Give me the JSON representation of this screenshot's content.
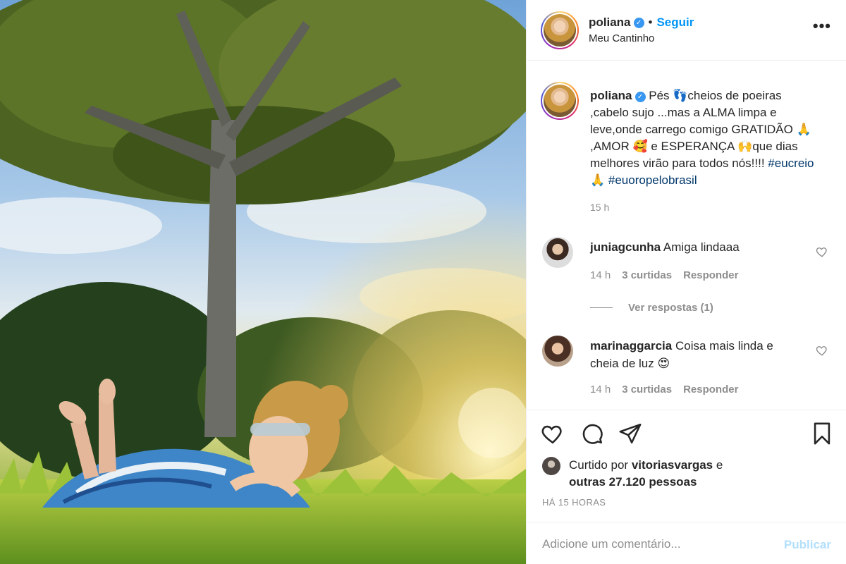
{
  "header": {
    "username": "poliana",
    "follow_label": "Seguir",
    "dot": "•",
    "location": "Meu Cantinho",
    "more_icon": "more-horizontal-icon"
  },
  "caption": {
    "username": "poliana",
    "text_part1": "Pés 👣cheios de poeiras ,cabelo sujo ...mas a ALMA limpa e leve,onde carrego comigo GRATIDÃO 🙏 ,AMOR 🥰 e ESPERANÇA 🙌que dias melhores virão para todos nós!!!! ",
    "tag1": "#eucreio",
    "tag_sep": "🙏 ",
    "tag2": "#euoropelobrasil",
    "time": "15 h"
  },
  "comments": [
    {
      "username": "juniagcunha",
      "text": "Amiga lindaaa",
      "time": "14 h",
      "likes": "3 curtidas",
      "reply_label": "Responder",
      "view_replies": "Ver respostas (1)"
    },
    {
      "username": "marinaggarcia",
      "text": "Coisa mais linda e cheia de luz 😍",
      "time": "14 h",
      "likes": "3 curtidas",
      "reply_label": "Responder"
    }
  ],
  "likes": {
    "prefix": "Curtido por",
    "user": "vitoriasvargas",
    "connector": "e",
    "others": "outras 27.120 pessoas"
  },
  "post_time": "HÁ 15 HORAS",
  "add_comment": {
    "placeholder": "Adicione um comentário...",
    "publish_label": "Publicar"
  },
  "colors": {
    "accent": "#0095f6",
    "hashtag": "#00376b",
    "muted": "#8e8e8e",
    "publish_disabled": "#b2dffc"
  }
}
